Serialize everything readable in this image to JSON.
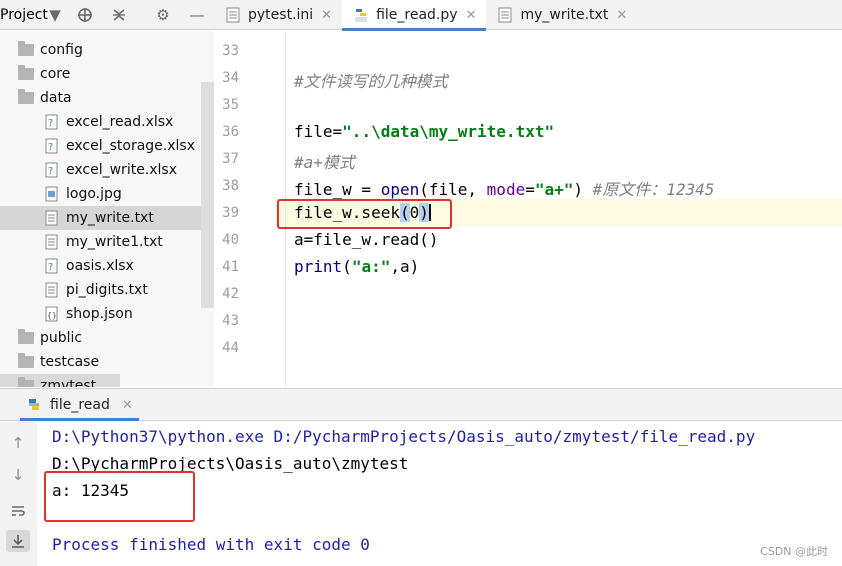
{
  "project_panel": {
    "title": "Project"
  },
  "tabs": [
    {
      "label": "pytest.ini",
      "active": false
    },
    {
      "label": "file_read.py",
      "active": true
    },
    {
      "label": "my_write.txt",
      "active": false
    }
  ],
  "tree": [
    {
      "label": "config",
      "kind": "folder"
    },
    {
      "label": "core",
      "kind": "folder"
    },
    {
      "label": "data",
      "kind": "folder-open"
    },
    {
      "label": "excel_read.xlsx",
      "kind": "xlsx"
    },
    {
      "label": "excel_storage.xlsx",
      "kind": "xlsx"
    },
    {
      "label": "excel_write.xlsx",
      "kind": "xlsx"
    },
    {
      "label": "logo.jpg",
      "kind": "image"
    },
    {
      "label": "my_write.txt",
      "kind": "text",
      "selected": true
    },
    {
      "label": "my_write1.txt",
      "kind": "text"
    },
    {
      "label": "oasis.xlsx",
      "kind": "xlsx"
    },
    {
      "label": "pi_digits.txt",
      "kind": "text"
    },
    {
      "label": "shop.json",
      "kind": "json"
    },
    {
      "label": "public",
      "kind": "folder"
    },
    {
      "label": "testcase",
      "kind": "folder"
    },
    {
      "label": "zmytest",
      "kind": "folder"
    }
  ],
  "editor": {
    "line_numbers": [
      "33",
      "34",
      "35",
      "36",
      "37",
      "38",
      "39",
      "40",
      "41",
      "42",
      "43",
      "44"
    ],
    "l34_comment": "#文件读写的几种模式",
    "l36_a": "file=",
    "l36_str": "\"..\\data\\my_write.txt\"",
    "l37_comment": "#a+模式",
    "l38_a": "file_w = ",
    "l38_open": "open",
    "l38_b": "(file, ",
    "l38_mode": "mode",
    "l38_c": "=",
    "l38_str": "\"a+\"",
    "l38_d": ") ",
    "l38_comment": "#原文件：12345",
    "l39_a": "file_w.seek",
    "l39_b": "(",
    "l39_c": "0",
    "l39_d": ")",
    "l40": "a=file_w.read()",
    "l41_print": "print",
    "l41_a": "(",
    "l41_str": "\"a:\"",
    "l41_b": ",a)"
  },
  "run_panel": {
    "tab_label": "file_read",
    "lines": [
      "D:\\Python37\\python.exe D:/PycharmProjects/Oasis_auto/zmytest/file_read.py",
      "D:\\PycharmProjects\\Oasis_auto\\zmytest",
      "a: 12345",
      "Process finished with exit code 0"
    ]
  },
  "watermark": "CSDN @此时",
  "colors": {
    "highlight_box": "#e53030",
    "accent": "#4083c9",
    "string": "#067d17",
    "comment": "#808080"
  }
}
